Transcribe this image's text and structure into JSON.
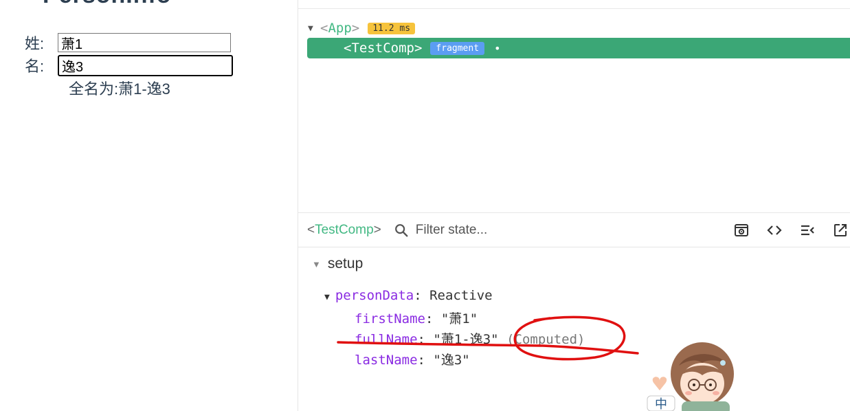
{
  "app": {
    "heading": "PersonInfo",
    "first_name_label": "姓:",
    "first_name_value": "萧1",
    "last_name_label": "名:",
    "last_name_value": "逸3",
    "fullname_text": "全名为:萧1-逸3"
  },
  "devtools": {
    "tree": {
      "root_open": "<",
      "root_name": "App",
      "root_close": ">",
      "root_badge": "11.2 ms",
      "child_open": "<",
      "child_name": "TestComp",
      "child_close": ">",
      "child_badge": "fragment",
      "child_dot": "•"
    },
    "inspector": {
      "comp_open": "<",
      "comp_name": "TestComp",
      "comp_close": ">",
      "filter_placeholder": "Filter state..."
    },
    "state": {
      "section_title": "setup",
      "object_key": "personData",
      "object_type": "Reactive",
      "fields": [
        {
          "key": "firstName",
          "value": "\"萧1\""
        },
        {
          "key": "fullName",
          "value": "\"萧1-逸3\"",
          "tag": "(Computed)"
        },
        {
          "key": "lastName",
          "value": "\"逸3\""
        }
      ]
    }
  },
  "colors": {
    "vue_green": "#42b883",
    "selected_bg": "#3ba776",
    "ms_badge": "#f6c33c",
    "fragment_badge": "#5b9df2",
    "state_key": "#8a2be2",
    "annotation_red": "#e01010"
  },
  "mascot": {
    "badge_text": "中"
  }
}
